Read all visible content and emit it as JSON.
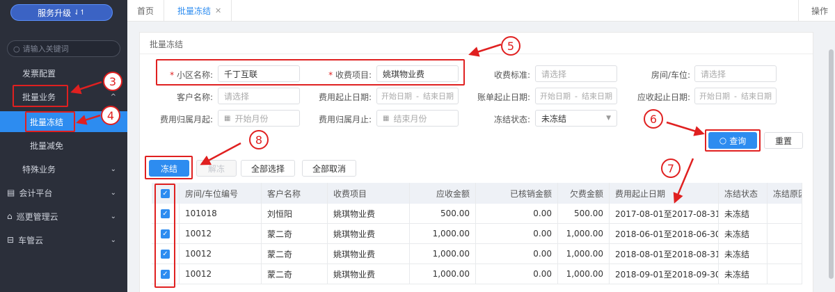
{
  "sidebar": {
    "upgrade_label": "服务升级",
    "upgrade_icon": "⇃↿",
    "search_placeholder": "请输入关键词",
    "items": [
      {
        "label": "发票配置"
      },
      {
        "label": "批量业务"
      },
      {
        "label": "批量冻结"
      },
      {
        "label": "批量减免"
      },
      {
        "label": "特殊业务"
      },
      {
        "label": "会计平台"
      },
      {
        "label": "巡更管理云"
      },
      {
        "label": "车管云"
      }
    ]
  },
  "topbar": {
    "tabs": [
      {
        "label": "首页"
      },
      {
        "label": "批量冻结"
      }
    ],
    "ops_label": "操作"
  },
  "panel": {
    "title": "批量冻结",
    "form": {
      "community_label": "小区名称:",
      "community_value": "千丁互联",
      "fee_item_label": "收费项目:",
      "fee_item_value": "姚琪物业费",
      "fee_std_label": "收费标准:",
      "fee_std_placeholder": "请选择",
      "room_label": "房间/车位:",
      "room_placeholder": "请选择",
      "customer_label": "客户名称:",
      "customer_placeholder": "请选择",
      "fee_date_label": "费用起止日期:",
      "bill_date_label": "账单起止日期:",
      "due_date_label": "应收起止日期:",
      "start_date_ph": "开始日期",
      "end_date_ph": "结束日期",
      "month_from_label": "费用归属月起:",
      "month_from_ph": "开始月份",
      "month_to_label": "费用归属月止:",
      "month_to_ph": "结束月份",
      "freeze_status_label": "冻结状态:",
      "freeze_status_value": "未冻结",
      "required_mark": "*"
    },
    "buttons": {
      "search": "查询",
      "reset": "重置",
      "freeze": "冻结",
      "unfreeze": "解冻",
      "select_all": "全部选择",
      "deselect_all": "全部取消"
    }
  },
  "table": {
    "headers": [
      "房间/车位编号",
      "客户名称",
      "收费项目",
      "应收金额",
      "已核销金额",
      "欠费金额",
      "费用起止日期",
      "冻结状态",
      "冻结原因"
    ],
    "rows": [
      {
        "room": "101018",
        "customer": "刘恒阳",
        "item": "姚琪物业费",
        "due": "500.00",
        "paid": "0.00",
        "owed": "500.00",
        "period": "2017-08-01至2017-08-31",
        "status": "未冻结",
        "reason": ""
      },
      {
        "room": "10012",
        "customer": "蒙二奇",
        "item": "姚琪物业费",
        "due": "1,000.00",
        "paid": "0.00",
        "owed": "1,000.00",
        "period": "2018-06-01至2018-06-30",
        "status": "未冻结",
        "reason": ""
      },
      {
        "room": "10012",
        "customer": "蒙二奇",
        "item": "姚琪物业费",
        "due": "1,000.00",
        "paid": "0.00",
        "owed": "1,000.00",
        "period": "2018-08-01至2018-08-31",
        "status": "未冻结",
        "reason": ""
      },
      {
        "room": "10012",
        "customer": "蒙二奇",
        "item": "姚琪物业费",
        "due": "1,000.00",
        "paid": "0.00",
        "owed": "1,000.00",
        "period": "2018-09-01至2018-09-30",
        "status": "未冻结",
        "reason": ""
      }
    ]
  },
  "annotations": [
    "3",
    "4",
    "5",
    "6",
    "7",
    "8"
  ],
  "colors": {
    "accent": "#2d8cf0",
    "annotation": "#e02020",
    "sidebar_bg": "#2b2f3a"
  }
}
